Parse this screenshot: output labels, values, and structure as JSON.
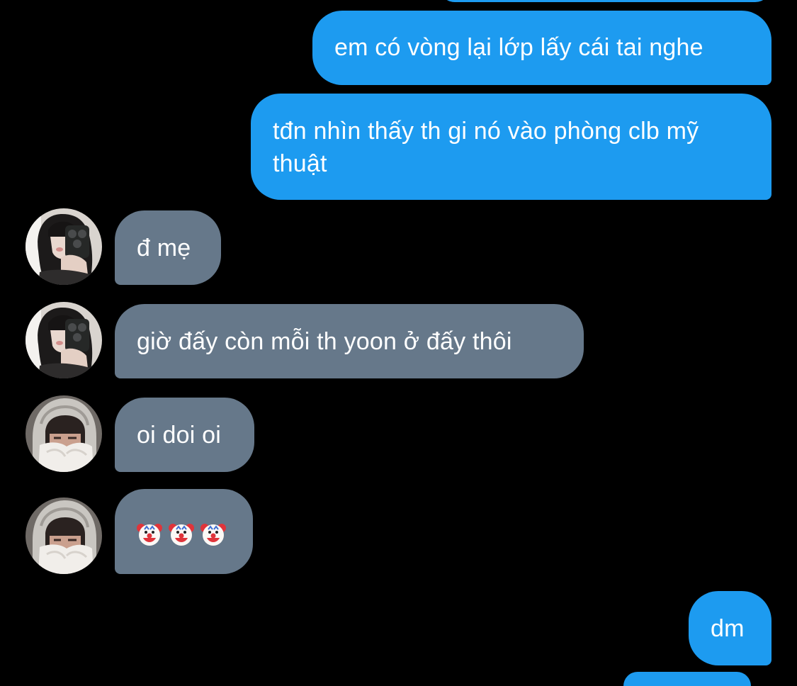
{
  "conversation": {
    "messages": [
      {
        "sender": "self",
        "text": "em có vòng lại lớp lấy cái tai nghe"
      },
      {
        "sender": "self",
        "text": "tđn nhìn thấy th gi nó vào phòng clb mỹ thuật"
      },
      {
        "sender": "other",
        "avatar": "avatar-girl-mirror-selfie",
        "text": "đ mẹ"
      },
      {
        "sender": "other",
        "avatar": "avatar-girl-mirror-selfie",
        "text": "giờ đấy còn mỗi th yoon ở đấy thôi"
      },
      {
        "sender": "other",
        "avatar": "avatar-hooded-boy",
        "text": "oi doi oi"
      },
      {
        "sender": "other",
        "avatar": "avatar-hooded-boy",
        "emoji": [
          "clown-face",
          "clown-face",
          "clown-face"
        ]
      },
      {
        "sender": "self",
        "text": "dm"
      }
    ]
  },
  "colors": {
    "background": "#000000",
    "outgoing_bubble": "#1d9bf0",
    "incoming_bubble": "#66788a",
    "text": "#ffffff"
  }
}
